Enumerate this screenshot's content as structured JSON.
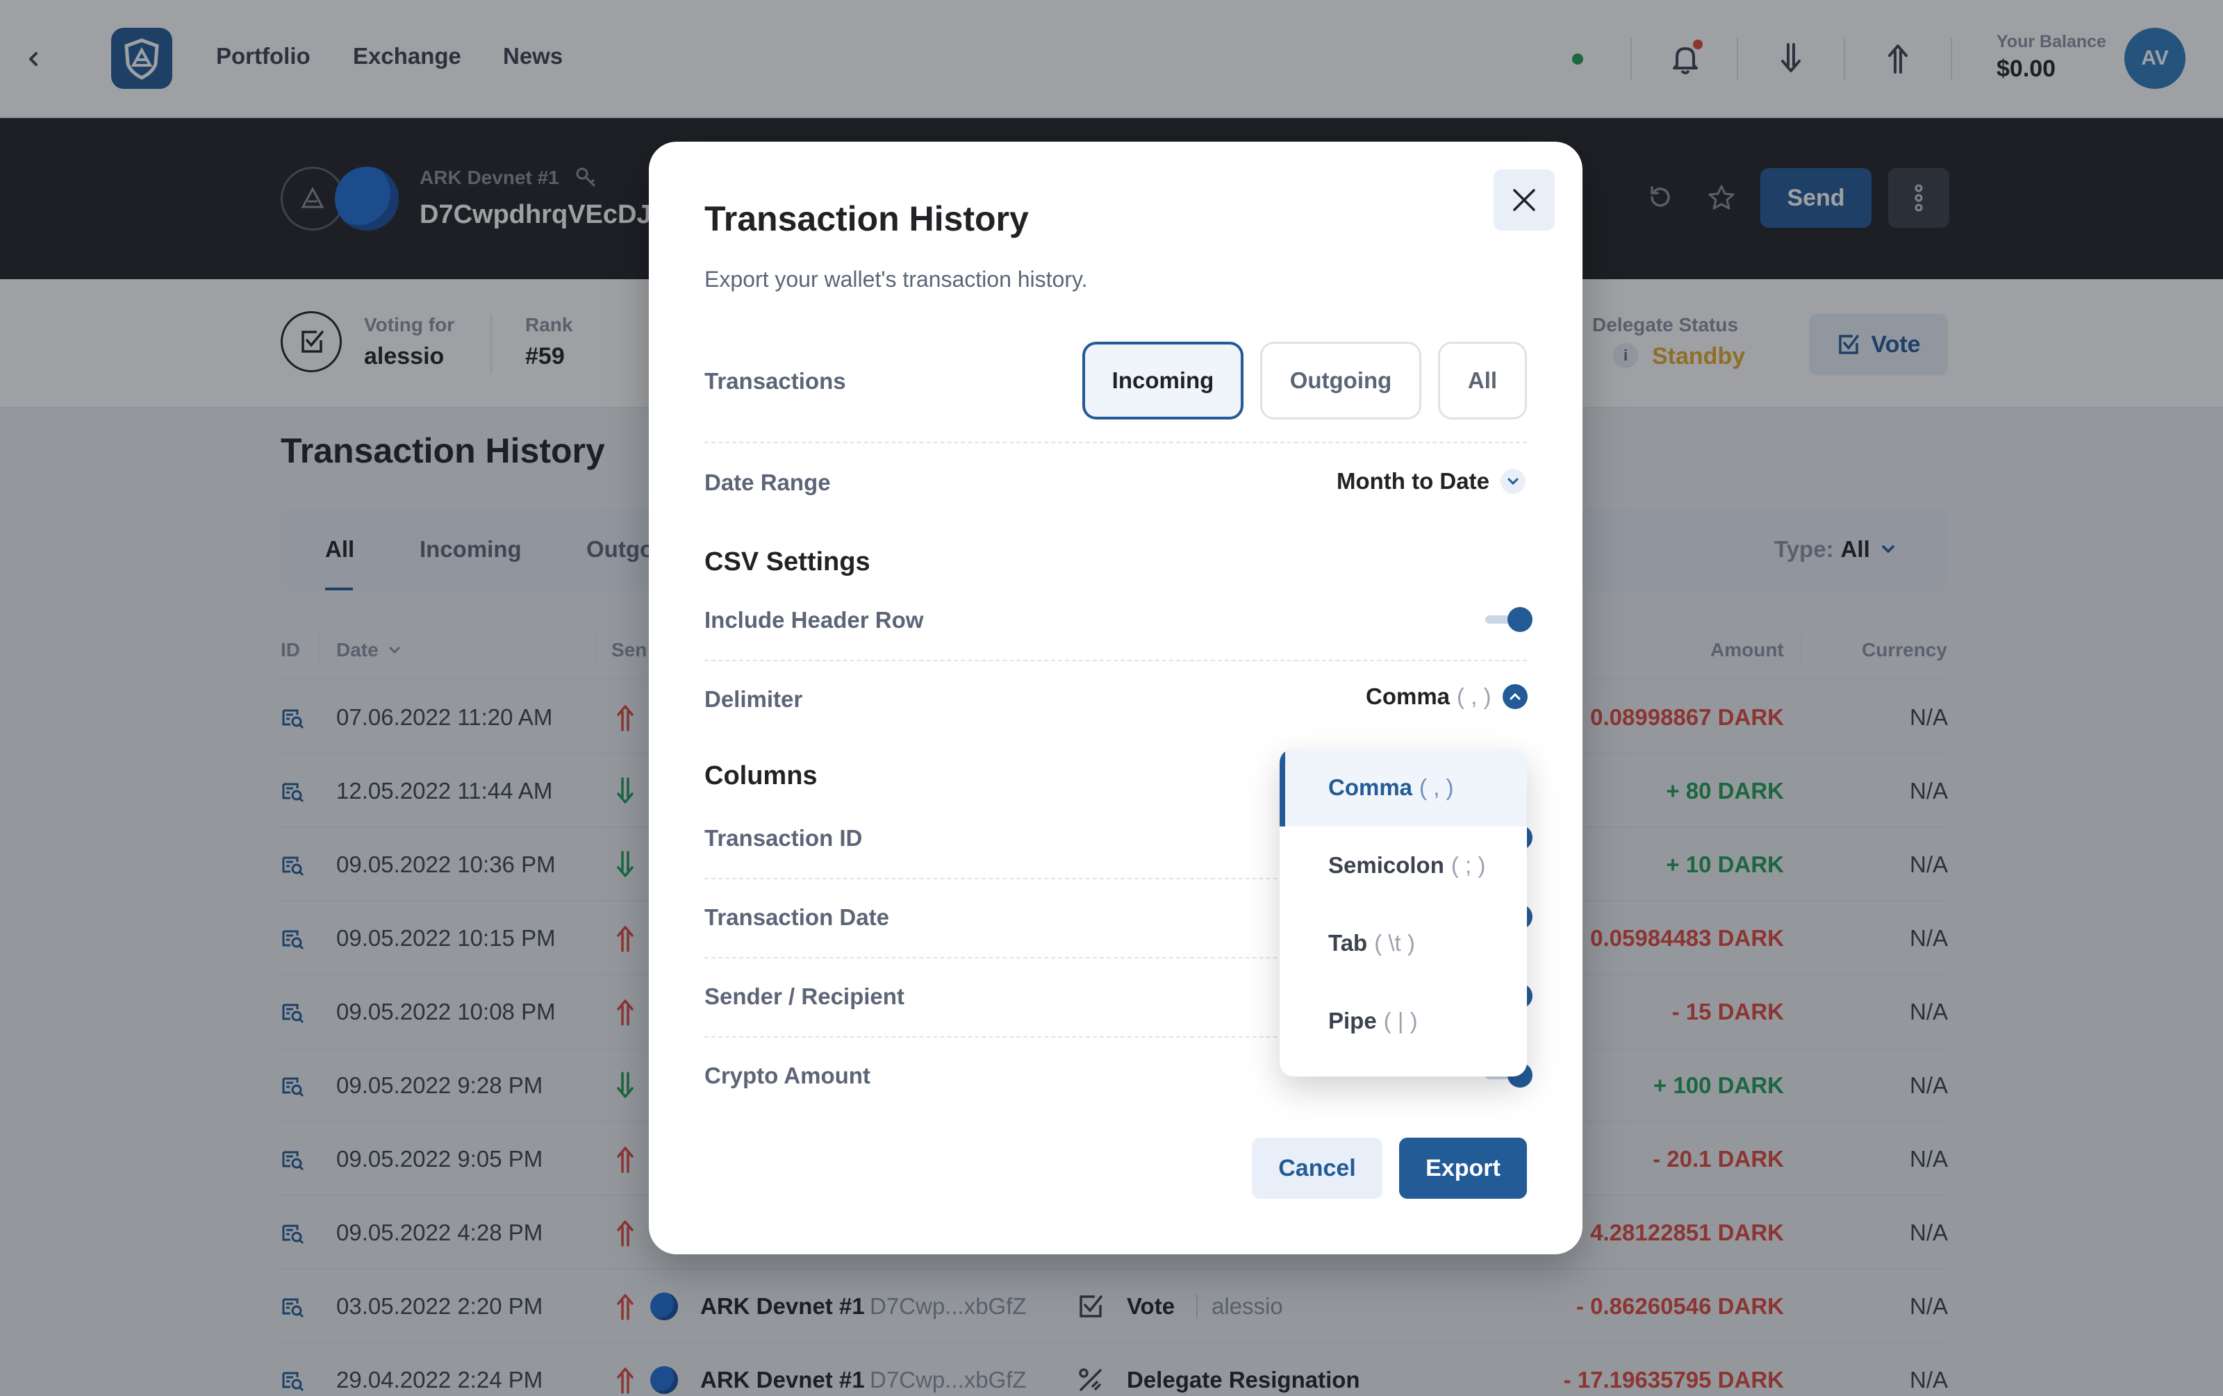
{
  "header": {
    "nav": [
      "Portfolio",
      "Exchange",
      "News"
    ],
    "balance_label": "Your Balance",
    "balance_value": "$0.00",
    "avatar_initials": "AV"
  },
  "wallet": {
    "name": "ARK Devnet #1",
    "address": "D7CwpdhrqVEcDJ",
    "send_label": "Send",
    "voting_for_label": "Voting for",
    "voting_for_value": "alessio",
    "rank_label": "Rank",
    "rank_value": "#59",
    "delegate_status_label": "Delegate Status",
    "delegate_status_value": "Standby",
    "vote_label": "Vote"
  },
  "history": {
    "title": "Transaction History",
    "tabs": [
      "All",
      "Incoming",
      "Outgo"
    ],
    "type_label": "Type:",
    "type_value": "All",
    "columns": {
      "id": "ID",
      "date": "Date",
      "sender": "Sen",
      "amount": "Amount",
      "currency": "Currency"
    },
    "rows": [
      {
        "date": "07.06.2022 11:20 AM",
        "dir": "out",
        "amount": "0.08998867 DARK",
        "currency": "N/A"
      },
      {
        "date": "12.05.2022 11:44 AM",
        "dir": "in",
        "amount": "+ 80 DARK",
        "currency": "N/A"
      },
      {
        "date": "09.05.2022 10:36 PM",
        "dir": "in",
        "amount": "+ 10 DARK",
        "currency": "N/A"
      },
      {
        "date": "09.05.2022 10:15 PM",
        "dir": "out",
        "amount": "0.05984483 DARK",
        "currency": "N/A"
      },
      {
        "date": "09.05.2022 10:08 PM",
        "dir": "out",
        "amount": "- 15 DARK",
        "currency": "N/A"
      },
      {
        "date": "09.05.2022 9:28 PM",
        "dir": "in",
        "amount": "+ 100 DARK",
        "currency": "N/A"
      },
      {
        "date": "09.05.2022 9:05 PM",
        "dir": "out",
        "amount": "- 20.1 DARK",
        "currency": "N/A"
      },
      {
        "date": "09.05.2022 4:28 PM",
        "dir": "out",
        "amount": "4.28122851 DARK",
        "currency": "N/A"
      },
      {
        "date": "03.05.2022 2:20 PM",
        "dir": "out",
        "wallet": "ARK Devnet #1",
        "addr": "D7Cwp...xbGfZ",
        "type": "Vote",
        "type_extra": "alessio",
        "amount": "- 0.86260546 DARK",
        "currency": "N/A"
      },
      {
        "date": "29.04.2022 2:24 PM",
        "dir": "out",
        "wallet": "ARK Devnet #1",
        "addr": "D7Cwp...xbGfZ",
        "type": "Delegate Resignation",
        "type_extra": "",
        "amount": "- 17.19635795 DARK",
        "currency": "N/A"
      }
    ]
  },
  "modal": {
    "title": "Transaction History",
    "description": "Export your wallet's transaction history.",
    "transactions_label": "Transactions",
    "segments": [
      "Incoming",
      "Outgoing",
      "All"
    ],
    "date_range_label": "Date Range",
    "date_range_value": "Month to Date",
    "csv_settings_heading": "CSV Settings",
    "include_header_label": "Include Header Row",
    "delimiter_label": "Delimiter",
    "delimiter_value": "Comma",
    "delimiter_value_symbol": "( , )",
    "columns_heading": "Columns",
    "column_options": [
      "Transaction ID",
      "Transaction Date",
      "Sender / Recipient",
      "Crypto Amount"
    ],
    "cancel_label": "Cancel",
    "export_label": "Export"
  },
  "delimiter_dropdown": {
    "options": [
      {
        "name": "Comma",
        "symbol": "( , )",
        "selected": true
      },
      {
        "name": "Semicolon",
        "symbol": "( ; )",
        "selected": false
      },
      {
        "name": "Tab",
        "symbol": "( \\t )",
        "selected": false
      },
      {
        "name": "Pipe",
        "symbol": "( | )",
        "selected": false
      }
    ]
  },
  "colors": {
    "primary": "#235b97",
    "negative": "#e0473d",
    "positive": "#1f9d55",
    "standby": "#e5a92a",
    "dark": "#212225"
  }
}
